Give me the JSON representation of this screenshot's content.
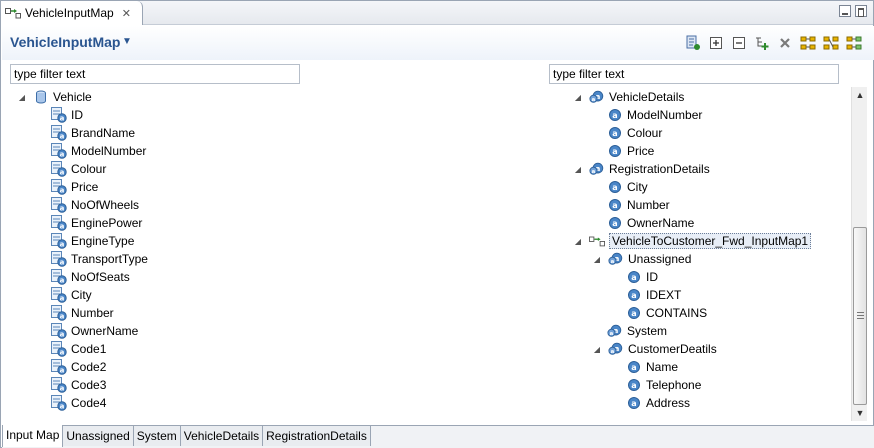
{
  "editor_tab": {
    "label": "VehicleInputMap",
    "close": "✕"
  },
  "header": {
    "title": "VehicleInputMap",
    "caret": "▼"
  },
  "toolbar": {
    "buttons": [
      "map-icon",
      "expand-all-icon",
      "collapse-all-icon",
      "add-mapping-icon",
      "delete-icon",
      "layout-1-icon",
      "layout-2-icon",
      "layout-3-icon"
    ]
  },
  "filters": {
    "left_value": "type filter text",
    "right_value": "type filter text"
  },
  "left_tree": {
    "root": "Vehicle",
    "items": [
      "ID",
      "BrandName",
      "ModelNumber",
      "Colour",
      "Price",
      "NoOfWheels",
      "EnginePower",
      "EngineType",
      "TransportType",
      "NoOfSeats",
      "City",
      "Number",
      "OwnerName",
      "Code1",
      "Code2",
      "Code3",
      "Code4"
    ]
  },
  "right_tree": {
    "vehicle_details": "VehicleDetails",
    "vehicle_details_items": [
      "ModelNumber",
      "Colour",
      "Price"
    ],
    "registration_details": "RegistrationDetails",
    "registration_details_items": [
      "City",
      "Number",
      "OwnerName"
    ],
    "mapping": "VehicleToCustomer_Fwd_InputMap1",
    "unassigned": "Unassigned",
    "unassigned_items": [
      "ID",
      "IDEXT",
      "CONTAINS"
    ],
    "system": "System",
    "customer_details": "CustomerDeatils",
    "customer_details_items": [
      "Name",
      "Telephone",
      "Address"
    ]
  },
  "bottom_tabs": [
    "Input Map",
    "Unassigned",
    "System",
    "VehicleDetails",
    "RegistrationDetails"
  ],
  "colors": {
    "title": "#2a5590",
    "attribute_icon": "#4a86c8"
  }
}
